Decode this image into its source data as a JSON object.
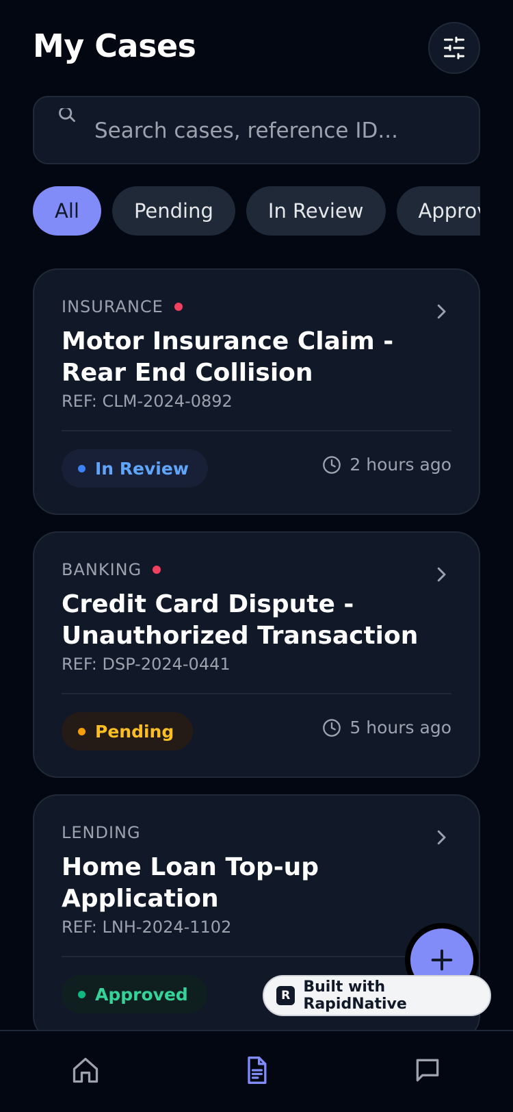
{
  "header": {
    "title": "My Cases"
  },
  "search": {
    "placeholder": "Search cases, reference ID..."
  },
  "filters": [
    {
      "label": "All",
      "active": true
    },
    {
      "label": "Pending",
      "active": false
    },
    {
      "label": "In Review",
      "active": false
    },
    {
      "label": "Approved",
      "active": false
    }
  ],
  "cases": [
    {
      "category": "INSURANCE",
      "unread": true,
      "title": "Motor Insurance Claim - Rear End Collision",
      "ref": "REF: CLM-2024-0892",
      "status": "In Review",
      "time": "2 hours ago"
    },
    {
      "category": "BANKING",
      "unread": true,
      "title": "Credit Card Dispute - Unauthorized Transaction",
      "ref": "REF: DSP-2024-0441",
      "status": "Pending",
      "time": "5 hours ago"
    },
    {
      "category": "LENDING",
      "unread": false,
      "title": "Home Loan Top-up Application",
      "ref": "REF: LNH-2024-1102",
      "status": "Approved",
      "time": ""
    }
  ],
  "badge": {
    "logo": "R",
    "text": "Built with RapidNative"
  },
  "tabbar": {
    "items": [
      {
        "icon": "home-icon",
        "label": "",
        "active": false
      },
      {
        "icon": "document-icon",
        "label": "",
        "active": true
      },
      {
        "icon": "chat-icon",
        "label": "",
        "active": false
      }
    ]
  },
  "colors": {
    "background": "#030712",
    "card": "#111827",
    "accent": "#818cf8",
    "review": "#60a5fa",
    "pending": "#fbbf24",
    "approved": "#34d399",
    "unread_dot": "#f43f5e"
  }
}
